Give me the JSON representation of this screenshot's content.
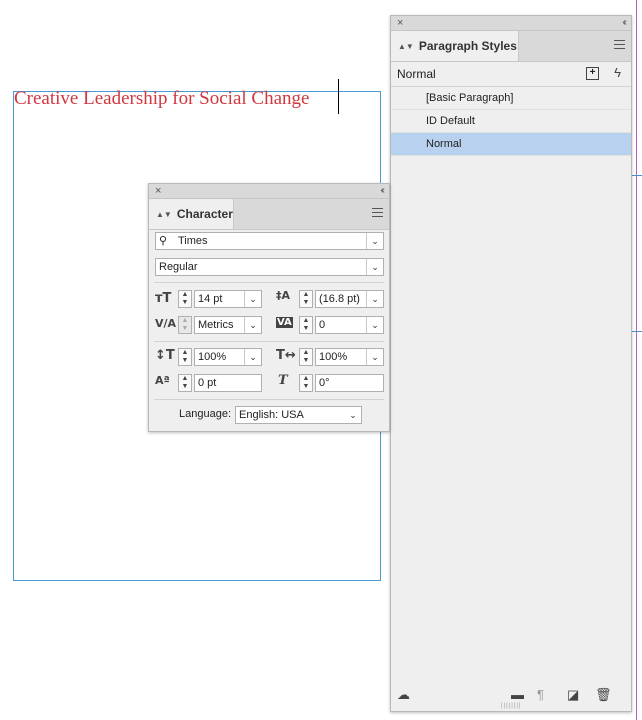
{
  "document": {
    "text": "Creative Leadership for Social Change"
  },
  "paragraph_styles": {
    "tab_label": "Paragraph Styles",
    "current_style": "Normal",
    "items": [
      {
        "label": "[Basic Paragraph]"
      },
      {
        "label": "ID Default"
      },
      {
        "label": "Normal"
      }
    ],
    "selected_index": 2
  },
  "character": {
    "tab_label": "Character",
    "font_family": "Times",
    "font_style": "Regular",
    "font_size": "14 pt",
    "leading": "(16.8 pt)",
    "kerning": "Metrics",
    "tracking": "0",
    "vertical_scale": "100%",
    "horizontal_scale": "100%",
    "baseline_shift": "0 pt",
    "skew": "0°",
    "language_label": "Language:",
    "language": "English: USA"
  },
  "colors": {
    "selection": "#b8d1ee",
    "doc_text": "#d2373f",
    "frame": "#4a9ad2"
  }
}
